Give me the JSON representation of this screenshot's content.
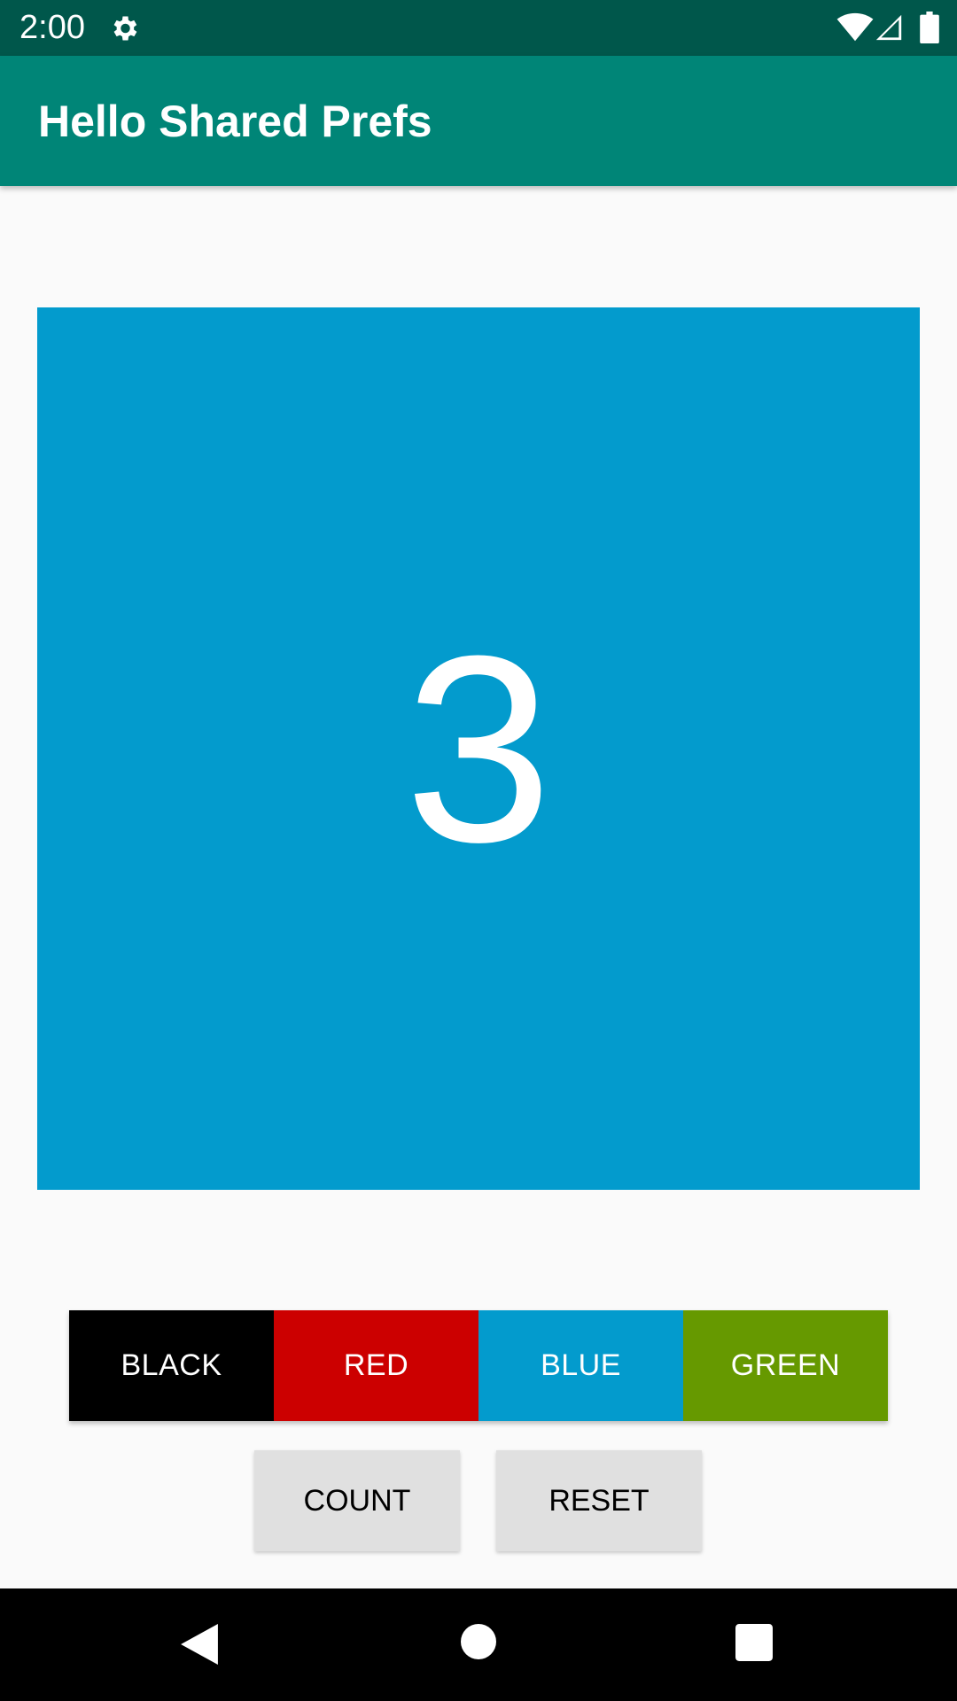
{
  "status_bar": {
    "time": "2:00",
    "icons": [
      "gear-icon",
      "wifi-icon",
      "cell-signal-icon",
      "battery-icon"
    ]
  },
  "app_bar": {
    "title": "Hello Shared Prefs"
  },
  "count_display": {
    "value": "3",
    "background_color": "#039bcd"
  },
  "color_buttons": [
    {
      "label": "BLACK",
      "color": "#000000"
    },
    {
      "label": "RED",
      "color": "#cc0000"
    },
    {
      "label": "BLUE",
      "color": "#039bcd"
    },
    {
      "label": "GREEN",
      "color": "#669900"
    }
  ],
  "actions": {
    "count_label": "COUNT",
    "reset_label": "RESET"
  },
  "nav_bar": {
    "icons": [
      "back-icon",
      "home-icon",
      "recents-icon"
    ]
  },
  "colors": {
    "status_bar": "#00574b",
    "app_bar": "#008577",
    "background": "#fafafa"
  }
}
